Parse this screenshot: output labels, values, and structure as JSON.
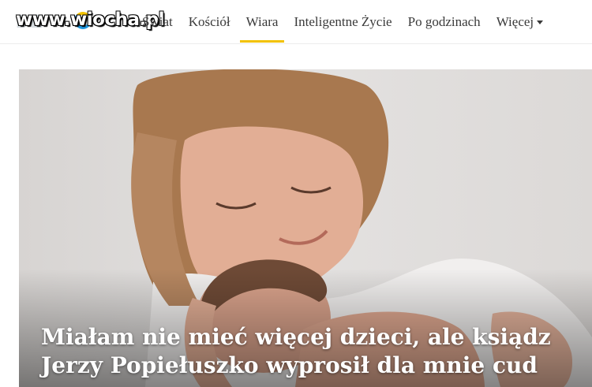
{
  "watermark": "www.wiocha.pl",
  "nav": {
    "items": [
      {
        "label": "Świat"
      },
      {
        "label": "Kościół"
      },
      {
        "label": "Wiara"
      },
      {
        "label": "Inteligentne Życie"
      },
      {
        "label": "Po godzinach"
      },
      {
        "label": "Więcej"
      }
    ],
    "active_item": "Wiara",
    "accent_color": "#f2c200"
  },
  "hero": {
    "headline": "Miałam nie mieć więcej dzieci, ale ksiądz Jerzy Popiełuszko wyprosił dla mnie cud"
  }
}
